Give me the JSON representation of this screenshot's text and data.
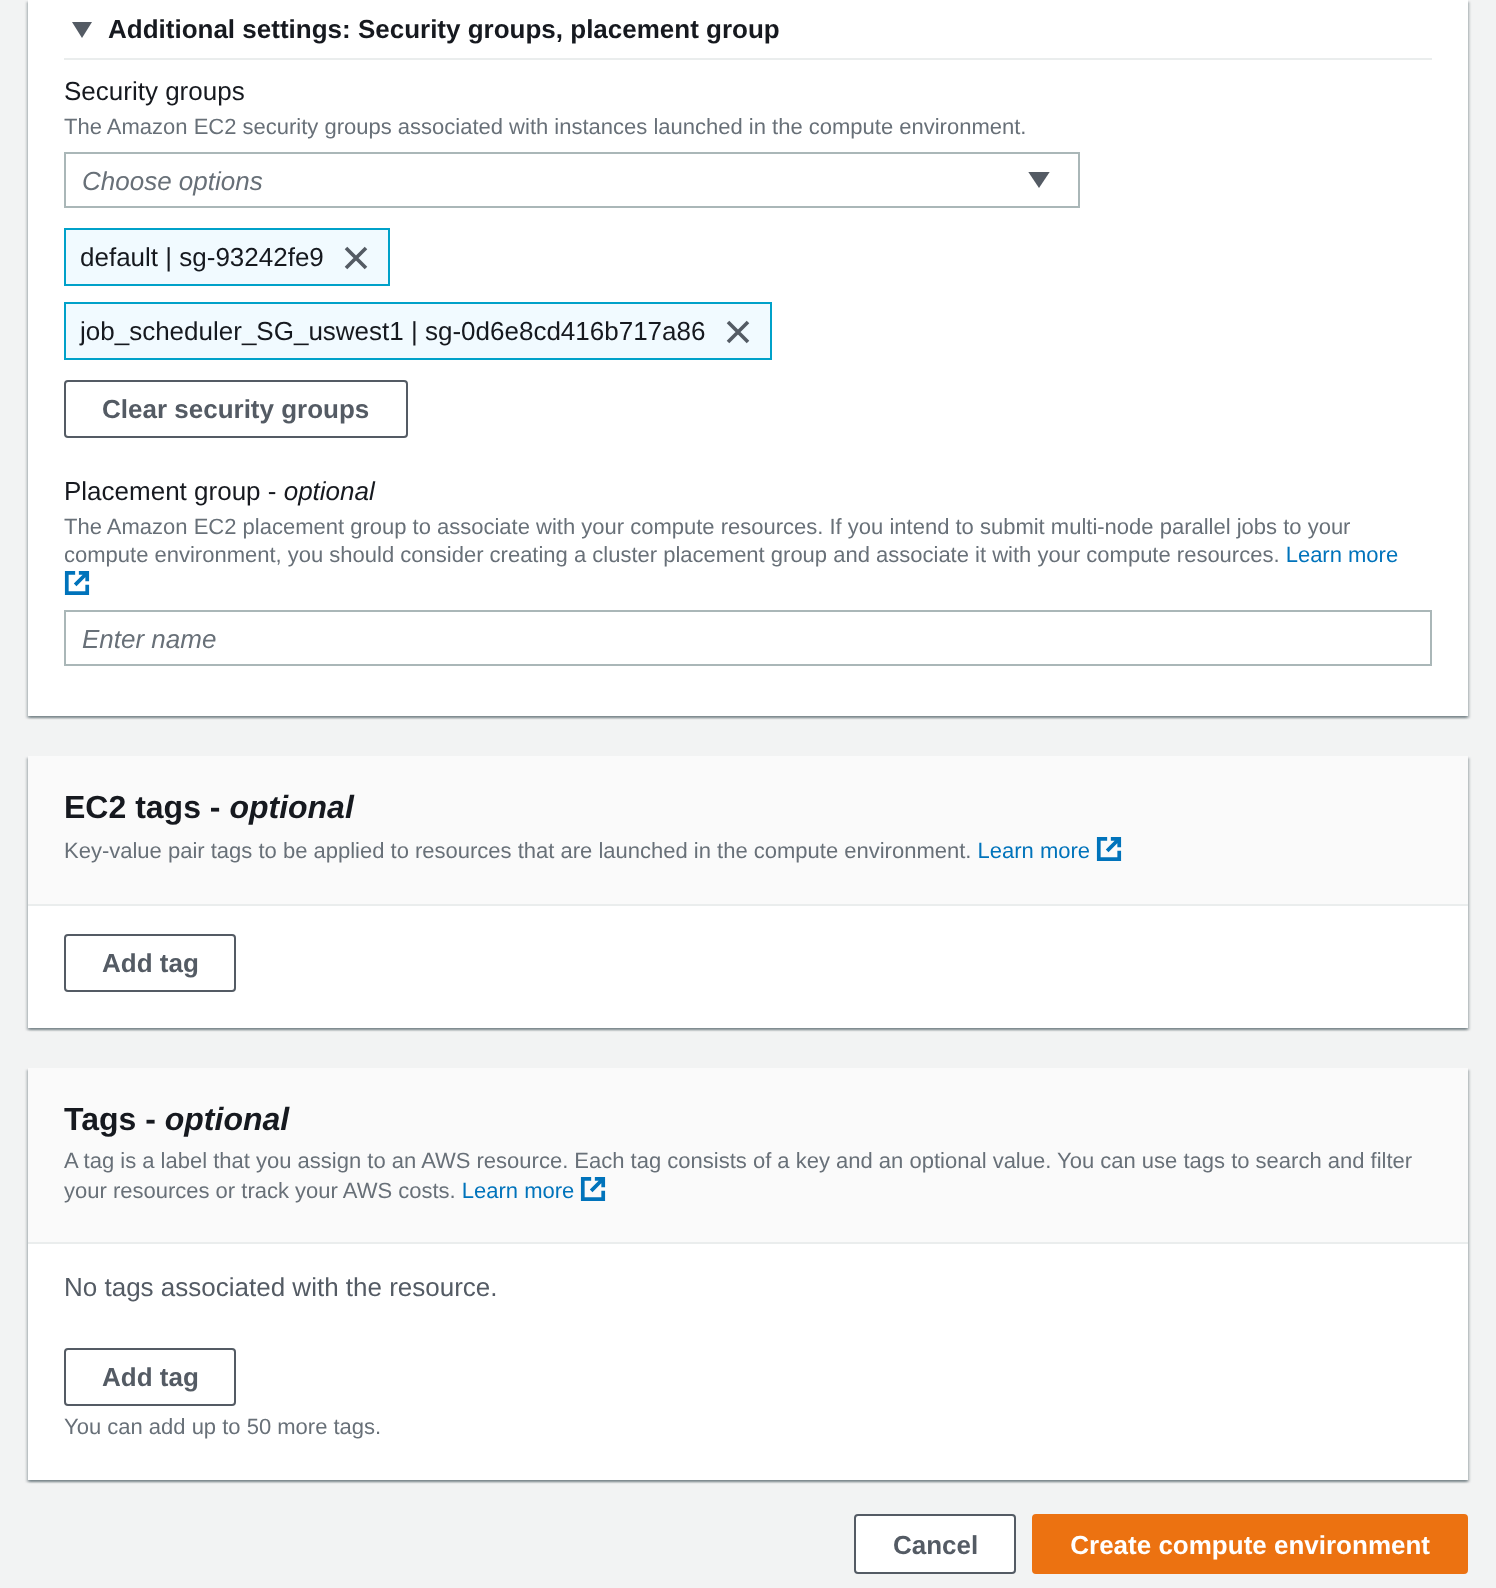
{
  "additional_settings": {
    "title": "Additional settings: Security groups, placement group",
    "expanded": true,
    "security_groups": {
      "label": "Security groups",
      "description": "The Amazon EC2 security groups associated with instances launched in the compute environment.",
      "placeholder": "Choose options",
      "tokens": [
        {
          "label": "default | sg-93242fe9"
        },
        {
          "label": "job_scheduler_SG_uswest1 | sg-0d6e8cd416b717a86"
        }
      ],
      "clear_button": "Clear security groups"
    },
    "placement_group": {
      "label": "Placement group - *optional*",
      "description": "The Amazon EC2 placement group to associate with your compute resources. If you intend to submit multi-node parallel jobs to your compute environment, you should consider creating a cluster placement group and associate it with your compute resources.",
      "link": "Learn more",
      "placeholder": "Enter name"
    }
  },
  "ec2_tags": {
    "title": "EC2 tags - *optional*",
    "description": "Key-value pair tags to be applied to resources that are launched in the compute environment.",
    "link": "Learn more",
    "add_button": "Add tag"
  },
  "tags": {
    "title": "Tags - *optional*",
    "description": "A tag is a label that you assign to an AWS resource. Each tag consists of a key and an optional value. You can use tags to search and filter your resources or track your AWS costs.",
    "link": "Learn more",
    "empty_message": "No tags associated with the resource.",
    "add_button": "Add tag",
    "hint": "You can add up to 50 more tags."
  },
  "footer": {
    "buttons": [
      {
        "label": "Cancel",
        "kind": "secondary"
      },
      {
        "label": "Create compute environment",
        "kind": "primary"
      }
    ]
  }
}
